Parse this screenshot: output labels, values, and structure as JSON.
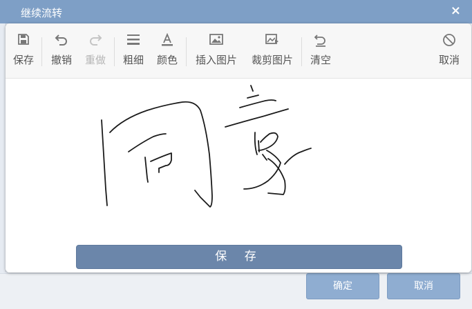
{
  "dialog": {
    "title": "继续流转",
    "close_glyph": "×",
    "ok_label": "确定",
    "cancel_label": "取消"
  },
  "toolbar": {
    "items": [
      {
        "label": "保存",
        "icon": "save-icon",
        "enabled": true
      },
      {
        "label": "撤销",
        "icon": "undo-icon",
        "enabled": true
      },
      {
        "label": "重做",
        "icon": "redo-icon",
        "enabled": false
      },
      {
        "label": "粗细",
        "icon": "line-weight-icon",
        "enabled": true
      },
      {
        "label": "颜色",
        "icon": "text-color-icon",
        "enabled": true
      },
      {
        "label": "插入图片",
        "icon": "insert-image-icon",
        "enabled": true
      },
      {
        "label": "裁剪图片",
        "icon": "crop-image-icon",
        "enabled": true
      },
      {
        "label": "清空",
        "icon": "clear-icon",
        "enabled": true
      },
      {
        "label": "取消",
        "icon": "cancel-icon",
        "enabled": true
      }
    ]
  },
  "signature": {
    "save_label": "保 存",
    "stroke_color": "#1a1a1a"
  },
  "colors": {
    "titlebar": "#7e9fc6",
    "save_button": "#6b86aa",
    "dialog_button": "#8fadd1"
  }
}
